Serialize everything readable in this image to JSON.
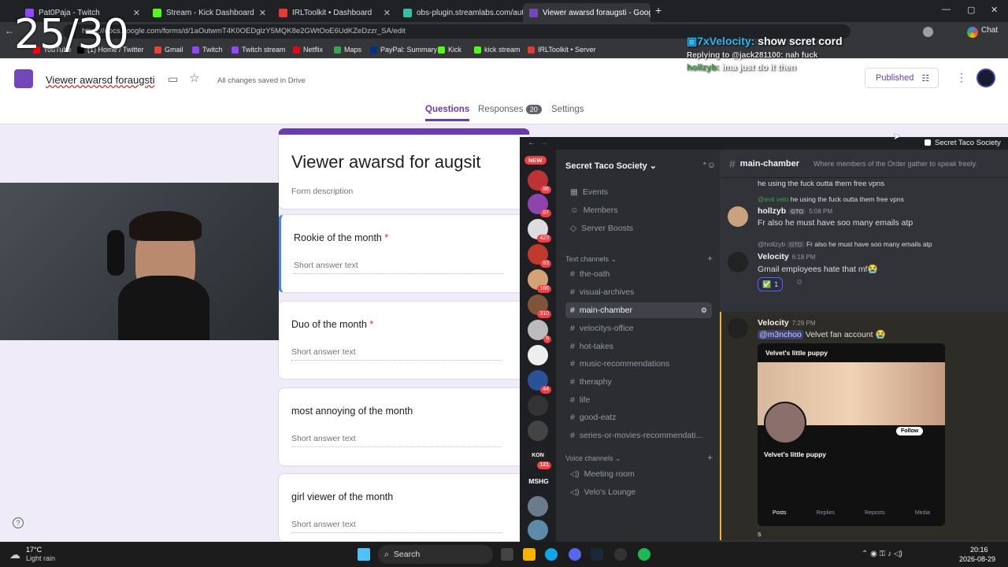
{
  "overlay": {
    "counter": "25/30"
  },
  "browser": {
    "tabs": [
      {
        "title": "Pat0Paja - Twitch",
        "color": "#9146ff"
      },
      {
        "title": "Stream - Kick Dashboard",
        "color": "#53fc18"
      },
      {
        "title": "IRLToolkit • Dashboard",
        "color": "#e53935"
      },
      {
        "title": "obs-plugin.streamlabs.com/auth/",
        "color": "#31c3a2"
      },
      {
        "title": "Viewer awarsd foraugsti - Google",
        "color": "#7248b9"
      }
    ],
    "url": "https://docs.google.com/forms/d/1aOutwmT4K0OEDglzY5MQK8e2GWtOoE6UdKZeDzzr_SA/edit",
    "chat_label": "Chat",
    "bookmarks": [
      {
        "label": "YouTube",
        "color": "#ff0000"
      },
      {
        "label": "(1) Home / Twitter",
        "color": "#000000"
      },
      {
        "label": "Gmail",
        "color": "#ea4335"
      },
      {
        "label": "Twitch",
        "color": "#9146ff"
      },
      {
        "label": "Twitch stream",
        "color": "#9146ff"
      },
      {
        "label": "Netflix",
        "color": "#e50914"
      },
      {
        "label": "Maps",
        "color": "#34a853"
      },
      {
        "label": "PayPal: Summary",
        "color": "#003087"
      },
      {
        "label": "Kick",
        "color": "#53fc18"
      },
      {
        "label": "kick stream",
        "color": "#53fc18"
      },
      {
        "label": "IRLToolkit • Server",
        "color": "#e53935"
      }
    ]
  },
  "form": {
    "doc_title": "Viewer awarsd foraugsti",
    "saved_status": "All changes saved in Drive",
    "published_label": "Published",
    "tabs": {
      "questions": "Questions",
      "responses": "Responses",
      "responses_count": "20",
      "settings": "Settings"
    },
    "title": "Viewer awarsd for augsit",
    "description_placeholder": "Form description",
    "questions": [
      {
        "label": "Rookie of the month",
        "required": "*",
        "placeholder": "Short answer text"
      },
      {
        "label": "Duo of the month",
        "required": "*",
        "placeholder": "Short answer text"
      },
      {
        "label": "most annoying of the month",
        "required": "",
        "placeholder": "Short answer text"
      },
      {
        "label": "girl viewer of the month",
        "required": "",
        "placeholder": "Short answer text"
      }
    ]
  },
  "chat_overlay": {
    "line1_user": "7xVelocity:",
    "line1_text": "show scret cord",
    "line2": "Replying to @jack281100: nah fuck",
    "line3_user": "hollzyb:",
    "line3_text": "ima just do it then"
  },
  "discord": {
    "window_title": "Secret Taco Society",
    "server_name": "Secret Taco Society",
    "server_badges": [
      "NEW",
      "86",
      "87",
      "423",
      "83",
      "166",
      "310",
      "9",
      "44",
      "121"
    ],
    "server_text_labels": [
      "KON",
      "MSHG"
    ],
    "nav": [
      "Events",
      "Members",
      "Server Boosts"
    ],
    "text_channels_label": "Text channels",
    "text_channels": [
      "the-oath",
      "visual-archives",
      "main-chamber",
      "velocitys-office",
      "hot-takes",
      "music-recommendations",
      "theraphy",
      "life",
      "good-eatz",
      "series-or-movies-recommendati..."
    ],
    "voice_channels_label": "Voice channels",
    "voice_channels": [
      "Meeting room",
      "Velo's Lounge"
    ],
    "channel": {
      "name": "main-chamber",
      "topic": "Where members of the Order gather to speak freely."
    },
    "messages": [
      {
        "text": "he using the fuck outta them free vpns"
      },
      {
        "reply_to": "@evil velo",
        "reply_text": "he using the fuck outta them free vpns",
        "user": "hollzyb",
        "tag": "GTO",
        "time": "5:08 PM",
        "text": "Fr also he must have soo many emails atp"
      },
      {
        "reply_to": "@hollzyb",
        "reply_tag": "GTO",
        "reply_text": "Fr also he must have soo many emails atp",
        "user": "Velocity",
        "time": "6:18 PM",
        "text": "Gmail employees hate that mf😭",
        "reaction": "✅",
        "reaction_count": "1"
      },
      {
        "user": "Velocity",
        "time": "7:29 PM",
        "mention": "@m3nchoo",
        "text": "Velvet fan account 😭"
      }
    ],
    "embed": {
      "header": "Velvet's little puppy",
      "profile_name": "Velvet's little puppy",
      "follow": "Follow",
      "tabs": [
        "Posts",
        "Replies",
        "Reposts",
        "Media"
      ]
    },
    "composer_text": "s"
  },
  "taskbar": {
    "temp": "17°C",
    "weather": "Light rain",
    "search": "Search",
    "time": "20:16",
    "date": "2026-08-29"
  }
}
